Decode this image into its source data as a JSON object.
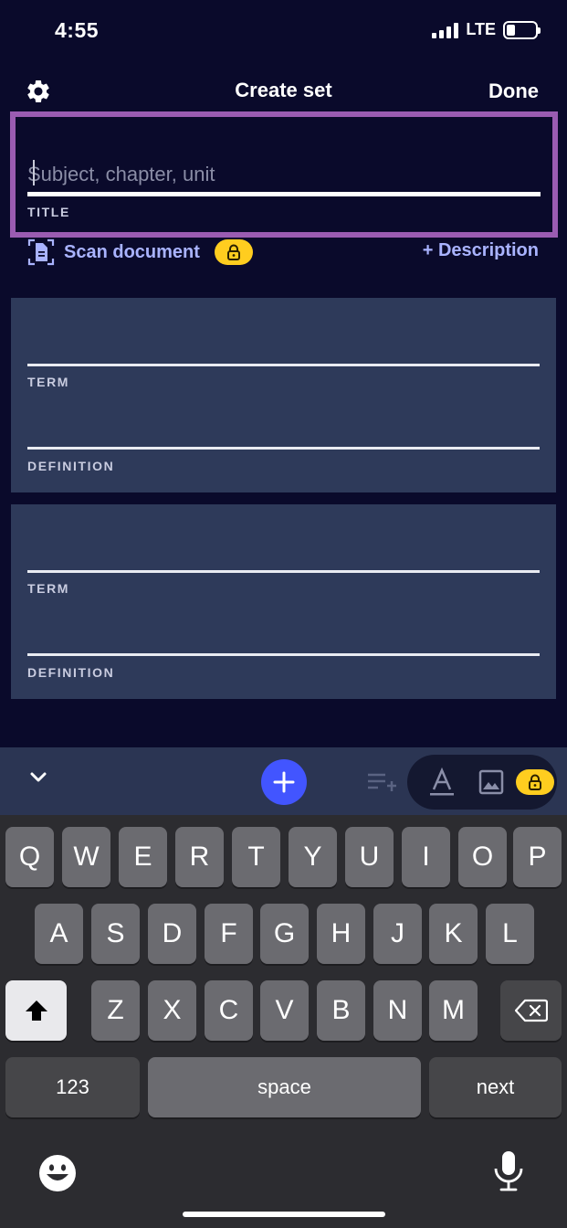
{
  "status": {
    "time": "4:55",
    "network": "LTE"
  },
  "header": {
    "title": "Create set",
    "done_label": "Done"
  },
  "title_field": {
    "placeholder": "Subject, chapter, unit",
    "value": "",
    "label": "TITLE"
  },
  "actions": {
    "scan_label": "Scan document",
    "description_label": "+ Description"
  },
  "cards": [
    {
      "term_label": "TERM",
      "definition_label": "DEFINITION"
    },
    {
      "term_label": "TERM",
      "definition_label": "DEFINITION"
    }
  ],
  "keyboard": {
    "row1": [
      "Q",
      "W",
      "E",
      "R",
      "T",
      "Y",
      "U",
      "I",
      "O",
      "P"
    ],
    "row2": [
      "A",
      "S",
      "D",
      "F",
      "G",
      "H",
      "J",
      "K",
      "L"
    ],
    "row3": [
      "Z",
      "X",
      "C",
      "V",
      "B",
      "N",
      "M"
    ],
    "numbers_label": "123",
    "space_label": "space",
    "next_label": "next"
  },
  "colors": {
    "background": "#0a0a2b",
    "focus_border": "#9a5cb2",
    "card": "#2e3a5a",
    "accent_link": "#a9b3ff",
    "primary_button": "#4255ff",
    "lock_badge": "#ffcd1f"
  },
  "icons": {
    "settings": "gear-icon",
    "scan": "document-scan-icon",
    "lock": "lock-icon",
    "collapse": "chevron-down-icon",
    "add": "plus-icon",
    "add_list": "add-list-icon",
    "text_format": "text-format-icon",
    "image": "image-icon",
    "shift": "shift-icon",
    "delete": "backspace-icon",
    "emoji": "emoji-icon",
    "mic": "microphone-icon"
  }
}
